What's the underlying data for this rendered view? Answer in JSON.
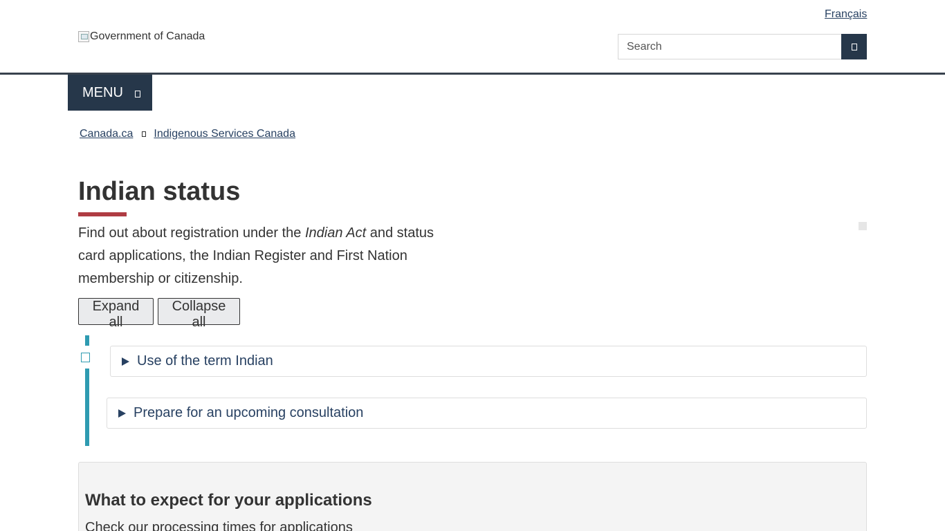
{
  "header": {
    "language_link": "Français",
    "logo_alt": "Government of Canada",
    "search_placeholder": "Search",
    "search_icon": "search-icon"
  },
  "menu": {
    "label": "MENU",
    "icon": "chevron-down-icon"
  },
  "breadcrumb": {
    "items": [
      {
        "label": "Canada.ca"
      },
      {
        "label": "Indigenous Services Canada"
      }
    ],
    "separator_icon": "chevron-right-icon"
  },
  "main": {
    "title": "Indian status",
    "intro_before": "Find out about registration under the ",
    "intro_italic": "Indian Act",
    "intro_after": " and status card applications, the Indian Register and First Nation membership or citizenship.",
    "buttons": {
      "expand_all": "Expand all",
      "collapse_all": "Collapse all"
    },
    "accordions": [
      {
        "label": "Use of the term Indian",
        "expanded": false
      },
      {
        "label": "Prepare for an upcoming consultation",
        "expanded": false
      }
    ]
  },
  "panel": {
    "title": "What to expect for your applications",
    "text": "Check our processing times for applications"
  },
  "colors": {
    "brand_dark": "#26374a",
    "link": "#284162",
    "title_accent": "#af3c43",
    "accordion_bar": "#2e9bb1",
    "panel_bg": "#f4f4f4"
  }
}
